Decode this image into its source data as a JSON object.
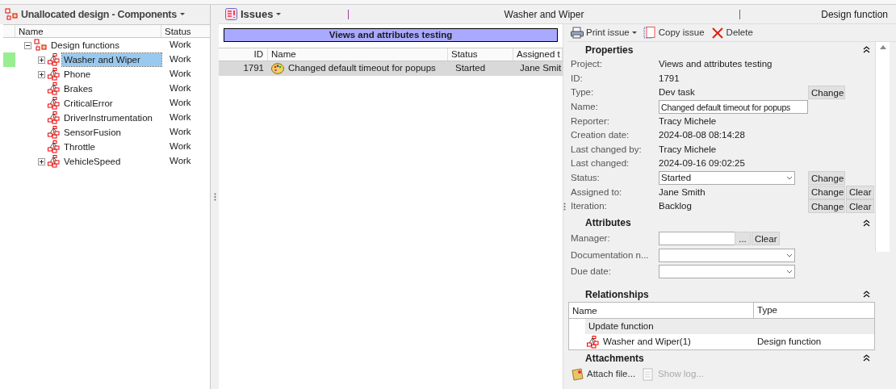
{
  "left_panel": {
    "title": "Unallocated design - Components",
    "columns": [
      "Name",
      "Status"
    ],
    "tree": [
      {
        "label": "Design functions",
        "status": "Work",
        "kind": "group",
        "collapsed": false,
        "selected": false,
        "children": [
          {
            "label": "Washer and Wiper",
            "status": "Work",
            "kind": "component",
            "collapsed": true,
            "selected": true
          },
          {
            "label": "Phone",
            "status": "Work",
            "kind": "component",
            "collapsed": true,
            "selected": false
          },
          {
            "label": "Brakes",
            "status": "Work",
            "kind": "component",
            "collapsed": false,
            "selected": false
          },
          {
            "label": "CriticalError",
            "status": "Work",
            "kind": "component",
            "collapsed": false,
            "selected": false
          },
          {
            "label": "DriverInstrumentation",
            "status": "Work",
            "kind": "component",
            "collapsed": false,
            "selected": false
          },
          {
            "label": "SensorFusion",
            "status": "Work",
            "kind": "component",
            "collapsed": false,
            "selected": false
          },
          {
            "label": "Throttle",
            "status": "Work",
            "kind": "component",
            "collapsed": false,
            "selected": false
          },
          {
            "label": "VehicleSpeed",
            "status": "Work",
            "kind": "component",
            "collapsed": true,
            "selected": false
          }
        ]
      }
    ]
  },
  "issues_bar": {
    "title": "Issues",
    "context": "Washer and Wiper",
    "context_type": "Design function"
  },
  "issues_list": {
    "project_banner": "Views and attributes testing",
    "columns": [
      "ID",
      "Name",
      "Status",
      "Assigned t"
    ],
    "rows": [
      {
        "id": "1791",
        "name": "Changed default timeout for popups",
        "status": "Started",
        "assigned": "Jane Smit",
        "selected": true
      }
    ]
  },
  "toolbar": [
    {
      "label": "Print issue",
      "kind": "print",
      "dropdown": true
    },
    {
      "label": "Copy issue",
      "kind": "copy",
      "dropdown": false
    },
    {
      "label": "Delete",
      "kind": "delete",
      "dropdown": false
    }
  ],
  "properties": {
    "title": "Properties",
    "rows": [
      {
        "label": "Project:",
        "value": "Views and attributes testing",
        "kind": "text",
        "buttons": []
      },
      {
        "label": "ID:",
        "value": "1791",
        "kind": "text",
        "buttons": []
      },
      {
        "label": "Type:",
        "value": "Dev task",
        "kind": "text",
        "buttons": [
          "Change"
        ]
      },
      {
        "label": "Name:",
        "value": "Changed default timeout for popups",
        "kind": "input",
        "buttons": []
      },
      {
        "label": "Reporter:",
        "value": "Tracy Michele",
        "kind": "text",
        "buttons": []
      },
      {
        "label": "Creation date:",
        "value": "2024-08-08 08:14:28",
        "kind": "text",
        "buttons": []
      },
      {
        "label": "Last changed by:",
        "value": "Tracy Michele",
        "kind": "text",
        "buttons": []
      },
      {
        "label": "Last changed:",
        "value": "2024-09-16 09:02:25",
        "kind": "text",
        "buttons": []
      },
      {
        "label": "Status:",
        "value": "Started",
        "kind": "select",
        "buttons": [
          "Change"
        ]
      },
      {
        "label": "Assigned to:",
        "value": "Jane Smith",
        "kind": "text",
        "buttons": [
          "Change",
          "Clear"
        ]
      },
      {
        "label": "Iteration:",
        "value": "Backlog",
        "kind": "text",
        "buttons": [
          "Change",
          "Clear"
        ]
      }
    ]
  },
  "attributes": {
    "title": "Attributes",
    "rows": [
      {
        "label": "Manager:",
        "kind": "picker",
        "buttons": [
          "...",
          "Clear"
        ]
      },
      {
        "label": "Documentation n...",
        "kind": "select",
        "buttons": []
      },
      {
        "label": "Due date:",
        "kind": "select",
        "buttons": []
      }
    ]
  },
  "relationships": {
    "title": "Relationships",
    "columns": [
      "Name",
      "Type"
    ],
    "groups": [
      {
        "label": "Update function",
        "items": [
          {
            "name": "Washer and Wiper(1)",
            "type": "Design function"
          }
        ]
      }
    ]
  },
  "attachments": {
    "title": "Attachments",
    "actions": [
      {
        "label": "Attach file...",
        "kind": "attach",
        "disabled": false
      },
      {
        "label": "Show log...",
        "kind": "log",
        "disabled": true
      }
    ]
  }
}
